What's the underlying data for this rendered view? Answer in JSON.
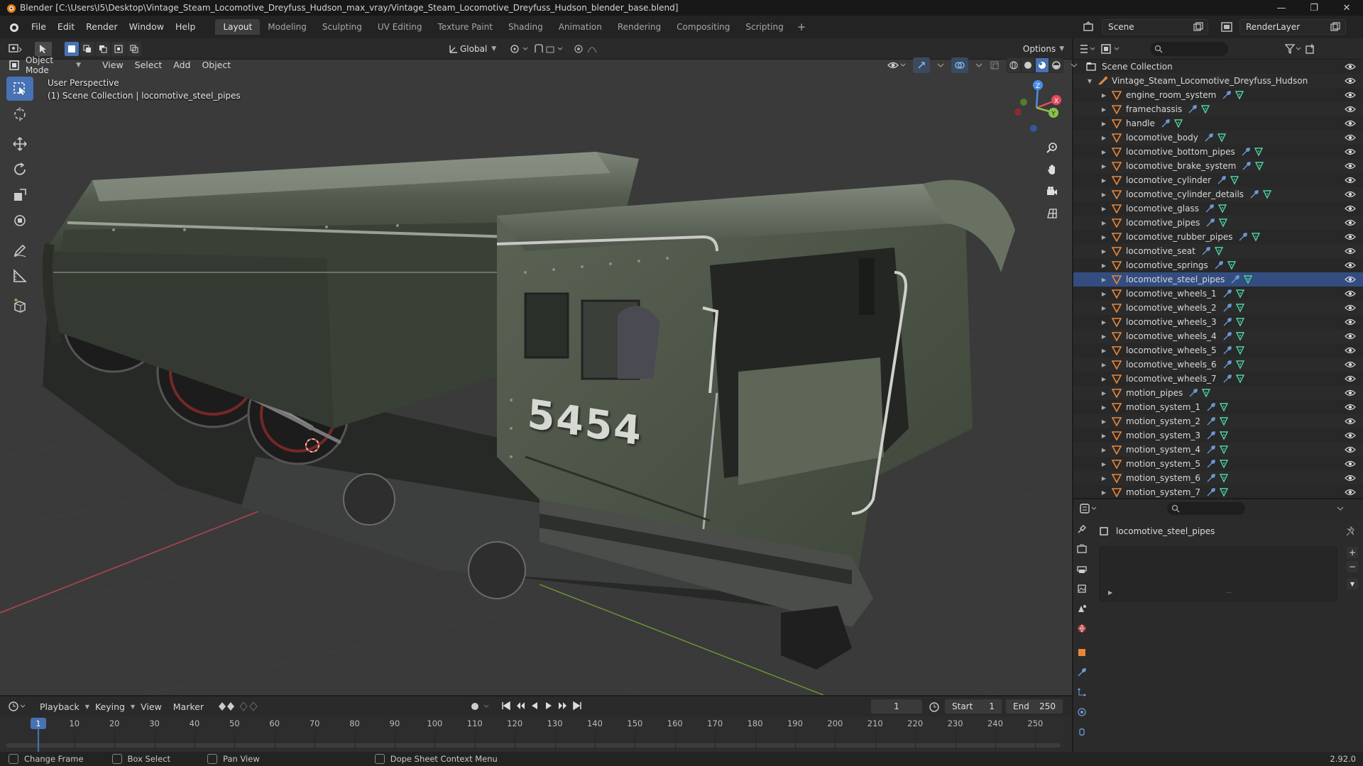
{
  "window": {
    "title": "Blender [C:\\Users\\I5\\Desktop\\Vintage_Steam_Locomotive_Dreyfuss_Hudson_max_vray/Vintage_Steam_Locomotive_Dreyfuss_Hudson_blender_base.blend]",
    "controls": [
      "—",
      "❐",
      "✕"
    ]
  },
  "menu": [
    "File",
    "Edit",
    "Render",
    "Window",
    "Help"
  ],
  "workspaces": {
    "tabs": [
      "Layout",
      "Modeling",
      "Sculpting",
      "UV Editing",
      "Texture Paint",
      "Shading",
      "Animation",
      "Rendering",
      "Compositing",
      "Scripting"
    ],
    "active": "Layout",
    "plus": "+"
  },
  "scene": {
    "name": "Scene",
    "render_layer": "RenderLayer"
  },
  "viewport_header": {
    "mode": "Object Mode",
    "menus": [
      "View",
      "Select",
      "Add",
      "Object"
    ],
    "orientation": "Global",
    "options": "Options"
  },
  "viewport": {
    "perspective": "User Perspective",
    "collection_info": "(1) Scene Collection | locomotive_steel_pipes",
    "number_plate": "5454",
    "gizmo": {
      "z": "Z",
      "y": "Y",
      "x": "X"
    }
  },
  "outliner": {
    "root": "Scene Collection",
    "collection": "Vintage_Steam_Locomotive_Dreyfuss_Hudson",
    "objects": [
      "engine_room_system",
      "framechassis",
      "handle",
      "locomotive_body",
      "locomotive_bottom_pipes",
      "locomotive_brake_system",
      "locomotive_cylinder",
      "locomotive_cylinder_details",
      "locomotive_glass",
      "locomotive_pipes",
      "locomotive_rubber_pipes",
      "locomotive_seat",
      "locomotive_springs",
      "locomotive_steel_pipes",
      "locomotive_wheels_1",
      "locomotive_wheels_2",
      "locomotive_wheels_3",
      "locomotive_wheels_4",
      "locomotive_wheels_5",
      "locomotive_wheels_6",
      "locomotive_wheels_7",
      "motion_pipes",
      "motion_system_1",
      "motion_system_2",
      "motion_system_3",
      "motion_system_4",
      "motion_system_5",
      "motion_system_6",
      "motion_system_7"
    ],
    "selected": "locomotive_steel_pipes"
  },
  "properties": {
    "object_name": "locomotive_steel_pipes"
  },
  "timeline": {
    "menus": [
      "Playback",
      "Keying",
      "View",
      "Marker"
    ],
    "current_frame": "1",
    "start_label": "Start",
    "start": "1",
    "end_label": "End",
    "end": "250",
    "ticks": [
      "1",
      "10",
      "20",
      "30",
      "40",
      "50",
      "60",
      "70",
      "80",
      "90",
      "100",
      "110",
      "120",
      "130",
      "140",
      "150",
      "160",
      "170",
      "180",
      "190",
      "200",
      "210",
      "220",
      "230",
      "240",
      "250"
    ]
  },
  "status": {
    "items": [
      "Change Frame",
      "Box Select",
      "Pan View",
      "Dope Sheet Context Menu"
    ],
    "version": "2.92.0"
  },
  "colors": {
    "accent": "#4772b3",
    "selection": "#334d80",
    "object_icon": "#e8873a",
    "modifier_icon": "#6b9bd6",
    "mesh_icon": "#4fd3a0",
    "x_axis": "#e84a5f",
    "y_axis": "#8bc34a",
    "z_axis": "#4a8fe8"
  }
}
